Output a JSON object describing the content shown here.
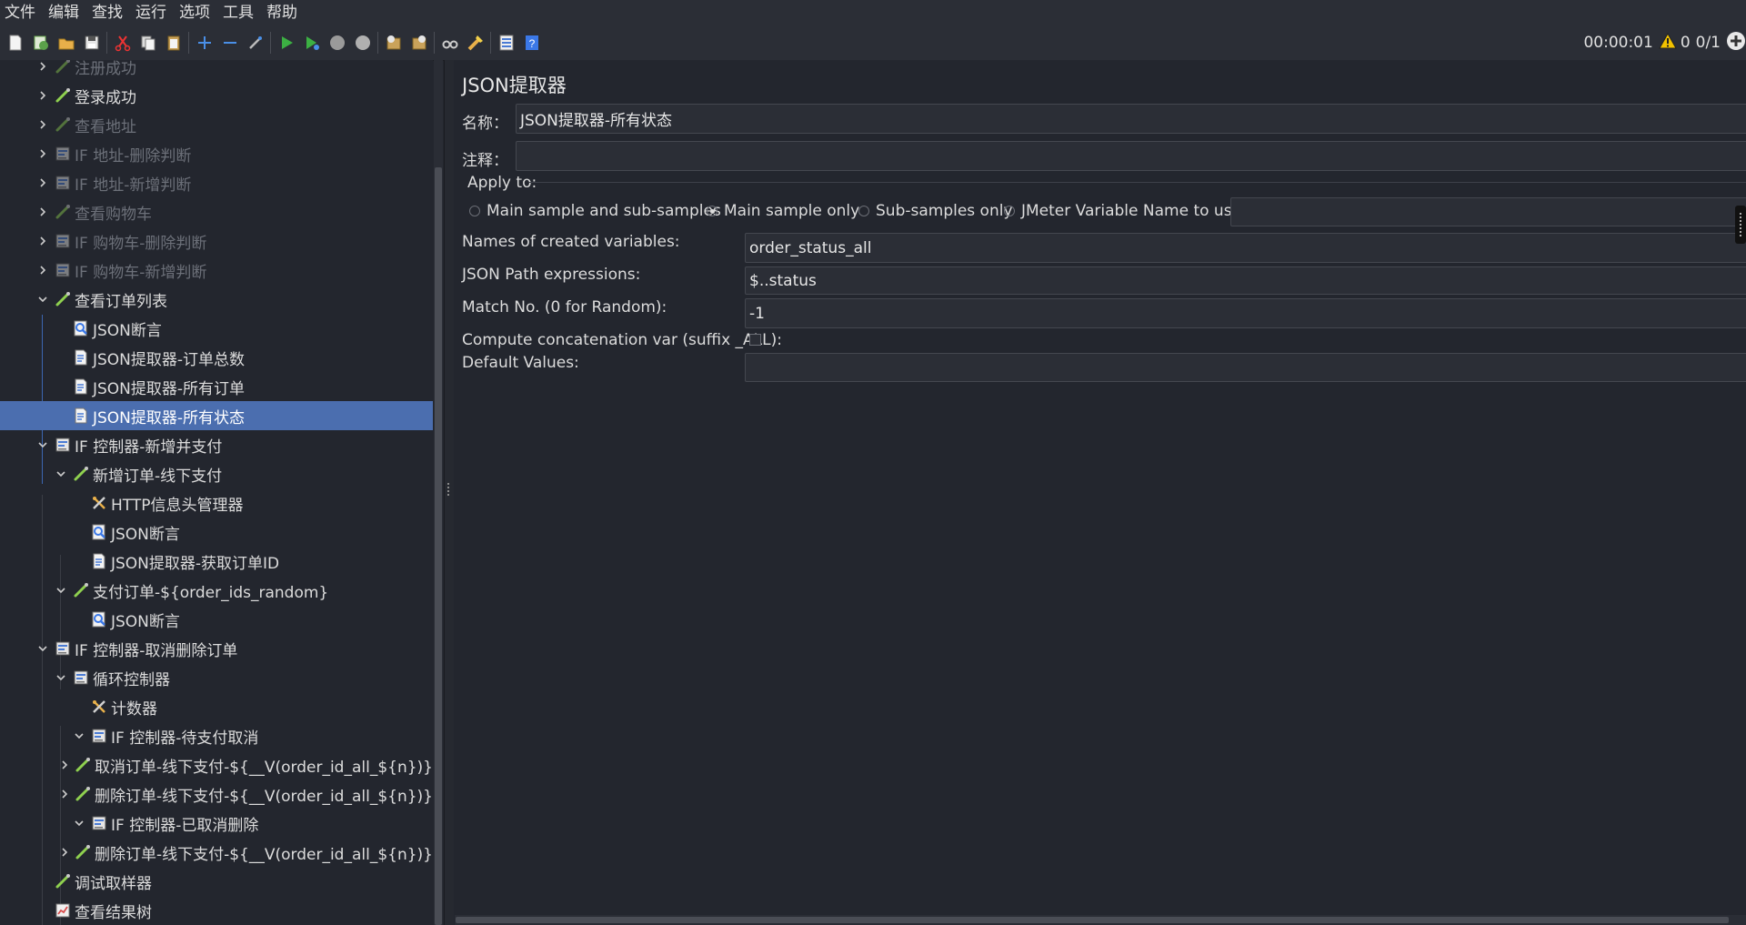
{
  "menu": [
    "文件",
    "编辑",
    "查找",
    "运行",
    "选项",
    "工具",
    "帮助"
  ],
  "toolbar": {
    "buttons": [
      "new-icon",
      "templates-icon",
      "open-icon",
      "save-icon",
      "cut-icon",
      "copy-icon",
      "paste-icon",
      "expand-icon",
      "collapse-icon",
      "toggle-icon",
      "start-icon",
      "start-no-pause-icon",
      "stop-icon",
      "shutdown-icon",
      "clear-icon",
      "clear-all-icon",
      "search-icon",
      "reset-search-icon",
      "function-helper-icon",
      "help-icon"
    ],
    "timer": "00:00:01",
    "warnings": "0",
    "threads": "0/1"
  },
  "tree": {
    "items": [
      {
        "label": "注册成功",
        "depth": 2,
        "icon": "sampler",
        "chev": "right",
        "disabled": true
      },
      {
        "label": "登录成功",
        "depth": 2,
        "icon": "sampler",
        "chev": "right",
        "disabled": false
      },
      {
        "label": "查看地址",
        "depth": 2,
        "icon": "sampler",
        "chev": "right",
        "disabled": true
      },
      {
        "label": "IF 地址-删除判断",
        "depth": 2,
        "icon": "controller",
        "chev": "right",
        "disabled": true
      },
      {
        "label": "IF 地址-新增判断",
        "depth": 2,
        "icon": "controller",
        "chev": "right",
        "disabled": true
      },
      {
        "label": "查看购物车",
        "depth": 2,
        "icon": "sampler",
        "chev": "right",
        "disabled": true
      },
      {
        "label": "IF 购物车-删除判断",
        "depth": 2,
        "icon": "controller",
        "chev": "right",
        "disabled": true
      },
      {
        "label": "IF 购物车-新增判断",
        "depth": 2,
        "icon": "controller",
        "chev": "right",
        "disabled": true
      },
      {
        "label": "查看订单列表",
        "depth": 2,
        "icon": "sampler",
        "chev": "down",
        "disabled": false
      },
      {
        "label": "JSON断言",
        "depth": 3,
        "icon": "assertion",
        "chev": "",
        "disabled": false
      },
      {
        "label": "JSON提取器-订单总数",
        "depth": 3,
        "icon": "extractor",
        "chev": "",
        "disabled": false
      },
      {
        "label": "JSON提取器-所有订单",
        "depth": 3,
        "icon": "extractor",
        "chev": "",
        "disabled": false
      },
      {
        "label": "JSON提取器-所有状态",
        "depth": 3,
        "icon": "extractor",
        "chev": "",
        "disabled": false,
        "selected": true
      },
      {
        "label": "IF 控制器-新增并支付",
        "depth": 2,
        "icon": "controller",
        "chev": "down",
        "disabled": false
      },
      {
        "label": "新增订单-线下支付",
        "depth": 3,
        "icon": "sampler",
        "chev": "down",
        "disabled": false
      },
      {
        "label": "HTTP信息头管理器",
        "depth": 4,
        "icon": "config",
        "chev": "",
        "disabled": false
      },
      {
        "label": "JSON断言",
        "depth": 4,
        "icon": "assertion",
        "chev": "",
        "disabled": false
      },
      {
        "label": "JSON提取器-获取订单ID",
        "depth": 4,
        "icon": "extractor",
        "chev": "",
        "disabled": false
      },
      {
        "label": "支付订单-${order_ids_random}",
        "depth": 3,
        "icon": "sampler",
        "chev": "down",
        "disabled": false
      },
      {
        "label": "JSON断言",
        "depth": 4,
        "icon": "assertion",
        "chev": "",
        "disabled": false
      },
      {
        "label": "IF 控制器-取消删除订单",
        "depth": 2,
        "icon": "controller",
        "chev": "down",
        "disabled": false
      },
      {
        "label": "循环控制器",
        "depth": 3,
        "icon": "controller",
        "chev": "down",
        "disabled": false
      },
      {
        "label": "计数器",
        "depth": 4,
        "icon": "config",
        "chev": "",
        "disabled": false
      },
      {
        "label": "IF 控制器-待支付取消",
        "depth": 4,
        "icon": "controller",
        "chev": "down",
        "disabled": false
      },
      {
        "label": "取消订单-线下支付-${__V(order_id_all_${n})}",
        "depth": 5,
        "icon": "sampler",
        "chev": "right",
        "disabled": false
      },
      {
        "label": "删除订单-线下支付-${__V(order_id_all_${n})}",
        "depth": 5,
        "icon": "sampler",
        "chev": "right",
        "disabled": false
      },
      {
        "label": "IF 控制器-已取消删除",
        "depth": 4,
        "icon": "controller",
        "chev": "down",
        "disabled": false
      },
      {
        "label": "删除订单-线下支付-${__V(order_id_all_${n})}",
        "depth": 5,
        "icon": "sampler",
        "chev": "right",
        "disabled": false
      },
      {
        "label": "调试取样器",
        "depth": 2,
        "icon": "sampler",
        "chev": "",
        "disabled": false
      },
      {
        "label": "查看结果树",
        "depth": 2,
        "icon": "listener",
        "chev": "",
        "disabled": false
      }
    ]
  },
  "panel": {
    "title": "JSON提取器",
    "name_label": "名称：",
    "name_value": "JSON提取器-所有状态",
    "comment_label": "注释：",
    "comment_value": "",
    "apply_to_label": "Apply to:",
    "apply_options": [
      {
        "label": "Main sample and sub-samples",
        "selected": false
      },
      {
        "label": "Main sample only",
        "selected": true
      },
      {
        "label": "Sub-samples only",
        "selected": false
      },
      {
        "label": "JMeter Variable Name to use",
        "selected": false
      }
    ],
    "variable_name_value": "",
    "vars_label": "Names of created variables:",
    "vars_value": "order_status_all",
    "path_label": "JSON Path expressions:",
    "path_value": "$..status",
    "match_label": "Match No. (0 for Random):",
    "match_value": "-1",
    "concat_label": "Compute concatenation var (suffix _ALL):",
    "concat_checked": false,
    "default_label": "Default Values:",
    "default_value": ""
  }
}
